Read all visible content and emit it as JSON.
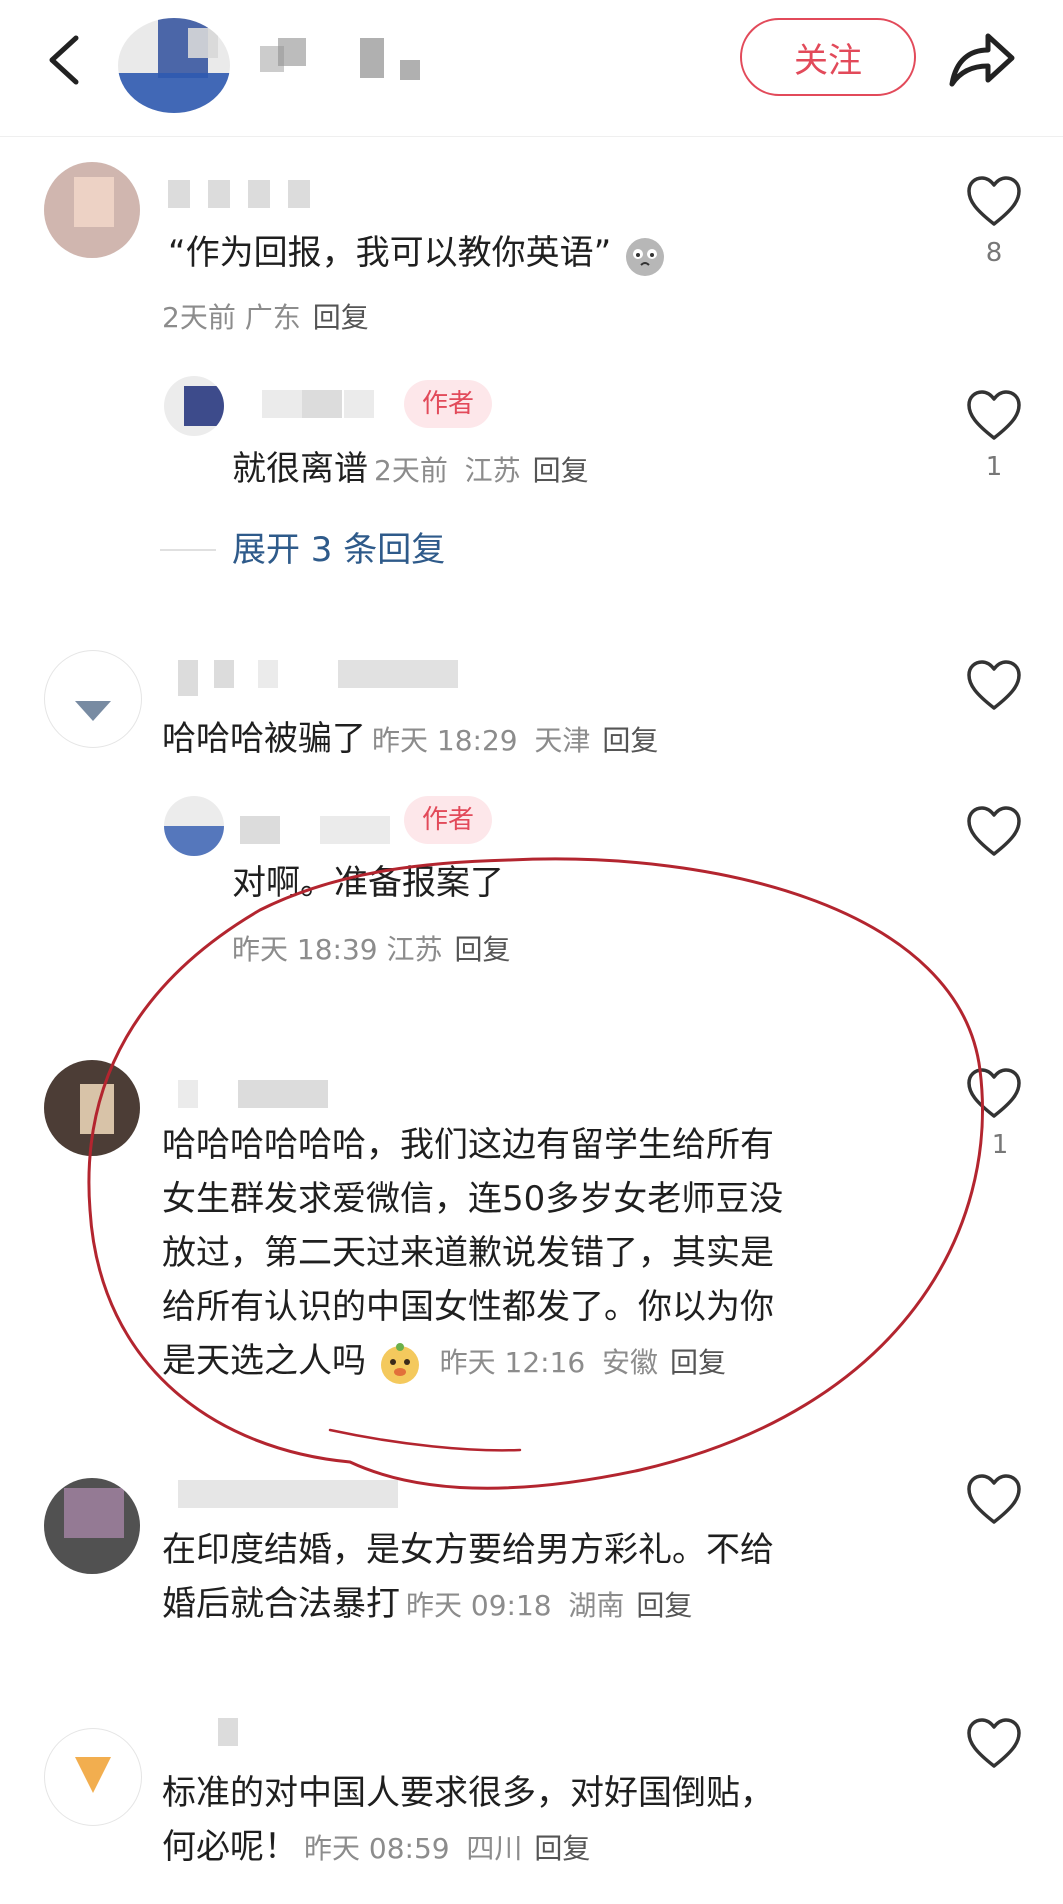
{
  "header": {
    "follow_label": "关注"
  },
  "comments": [
    {
      "text": "“作为回报，我可以教你英语”",
      "time": "2天前",
      "location": "广东",
      "reply_label": "回复",
      "likes": "8",
      "replies": [
        {
          "author_tag": "作者",
          "text": "就很离谱",
          "time": "2天前",
          "location": "江苏",
          "reply_label": "回复",
          "likes": "1"
        }
      ],
      "expand_label": "展开 3 条回复"
    },
    {
      "text": "哈哈哈被骗了",
      "time": "昨天 18:29",
      "location": "天津",
      "reply_label": "回复",
      "replies": [
        {
          "author_tag": "作者",
          "text": "对啊。准备报案了",
          "time": "昨天 18:39",
          "location": "江苏",
          "reply_label": "回复"
        }
      ]
    },
    {
      "text_lines": [
        "哈哈哈哈哈哈，我们这边有留学生给所有",
        "女生群发求爱微信，连50多岁女老师豆没",
        "放过，第二天过来道歉说发错了，其实是",
        "给所有认识的中国女性都发了。你以为你",
        "是天选之人吗"
      ],
      "time": "昨天 12:16",
      "location": "安徽",
      "reply_label": "回复",
      "likes": "1"
    },
    {
      "text_lines": [
        "在印度结婚，是女方要给男方彩礼。不给",
        "婚后就合法暴打"
      ],
      "time": "昨天 09:18",
      "location": "湖南",
      "reply_label": "回复"
    },
    {
      "text_lines": [
        "标准的对中国人要求很多，对好国倒贴，",
        "何必呢！"
      ],
      "time": "昨天 08:59",
      "location": "四川",
      "reply_label": "回复"
    }
  ],
  "colors": {
    "accent": "#e24a5a",
    "link": "#2e5a8a",
    "annotation_circle": "#b3252f"
  }
}
